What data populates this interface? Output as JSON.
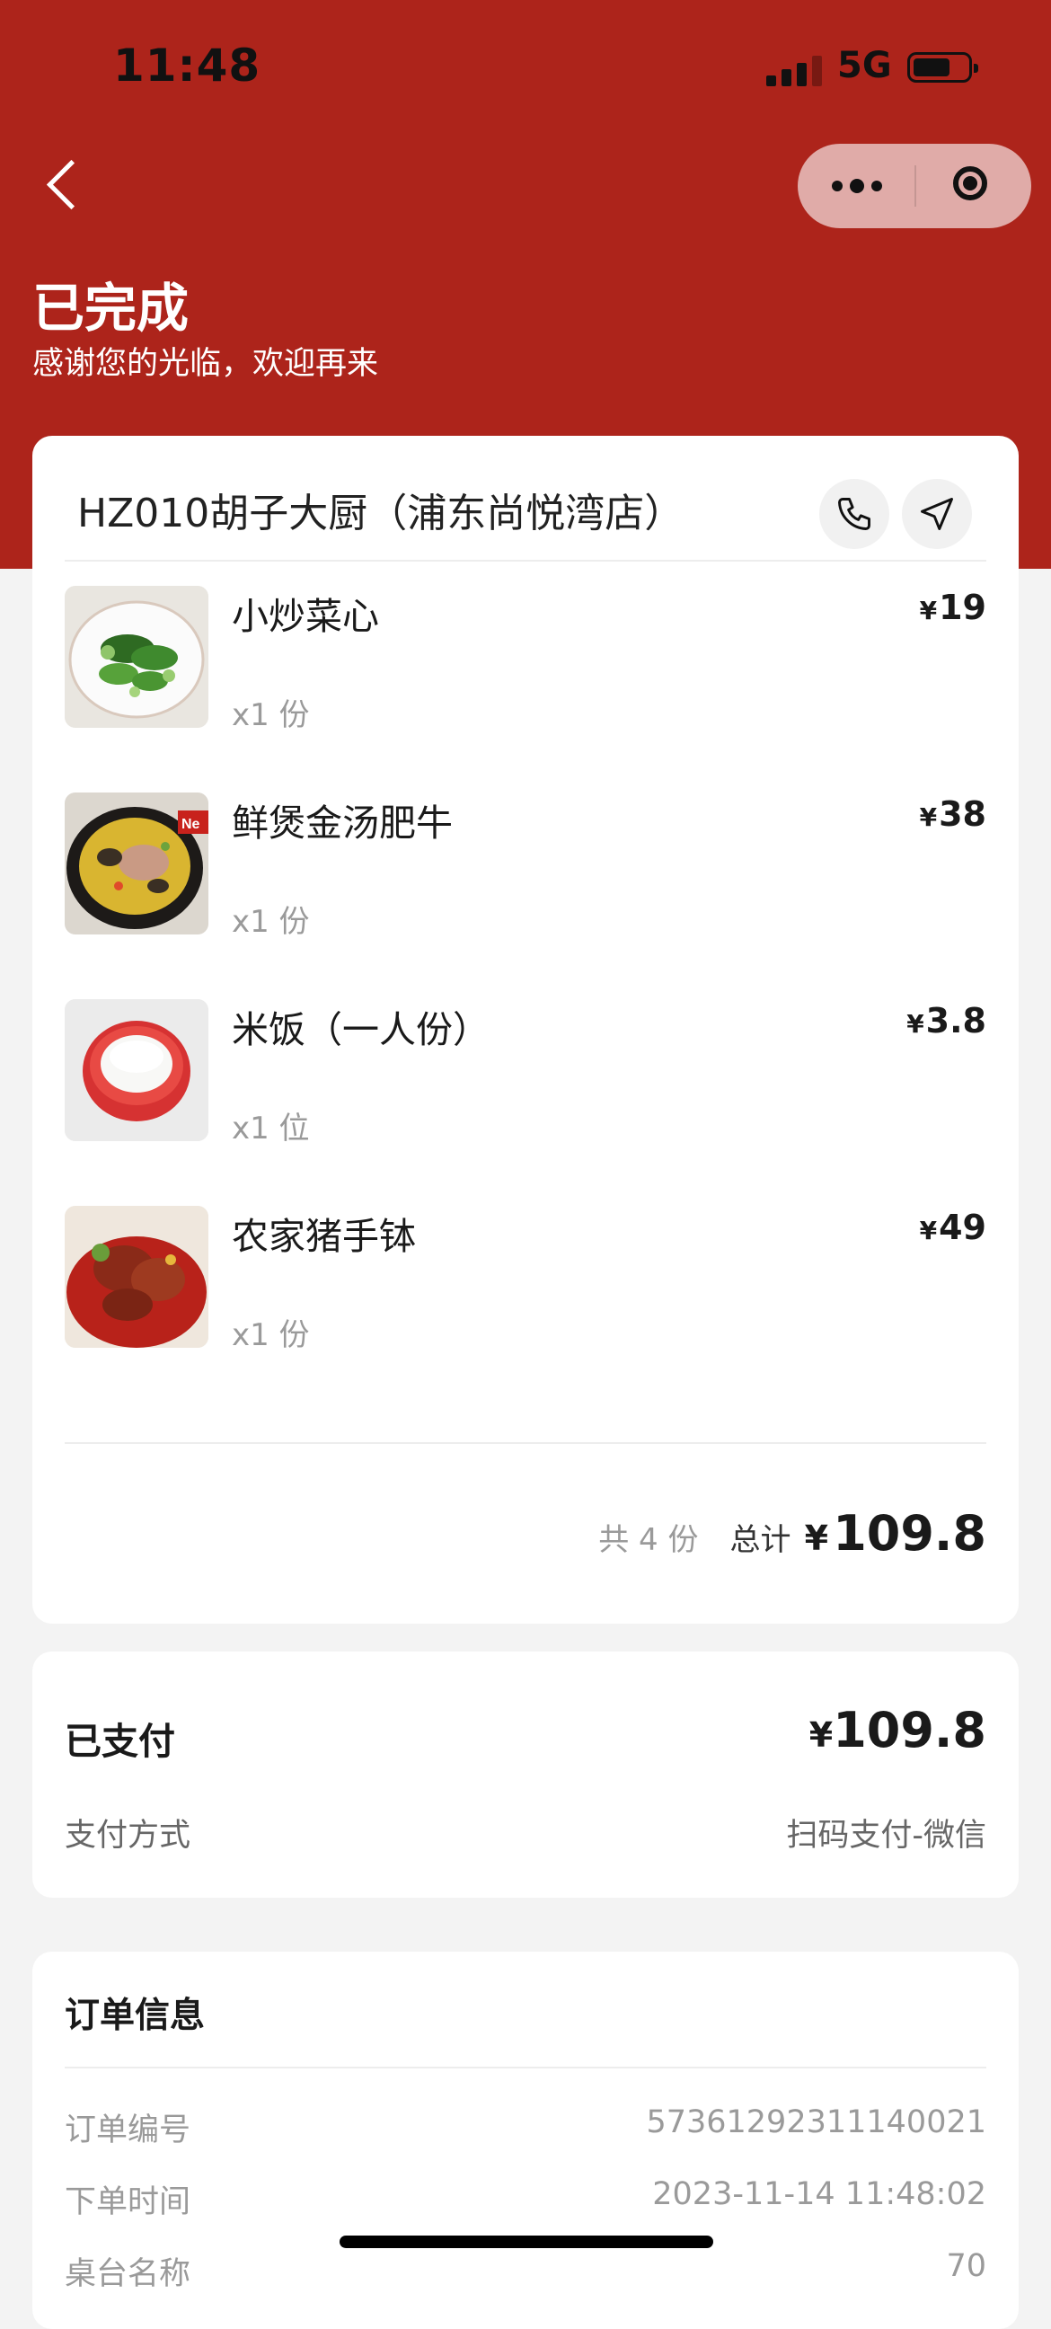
{
  "status_bar": {
    "time": "11:48",
    "network": "5G"
  },
  "header": {
    "status_title": "已完成",
    "status_subtitle": "感谢您的光临，欢迎再来"
  },
  "store": {
    "name": "HZ010胡子大厨（浦东尚悦湾店）"
  },
  "items": [
    {
      "name": "小炒菜心",
      "qty": "x1 份",
      "yen": "¥",
      "price": "19"
    },
    {
      "name": "鲜煲金汤肥牛",
      "qty": "x1 份",
      "yen": "¥",
      "price": "38"
    },
    {
      "name": "米饭（一人份）",
      "qty": "x1 位",
      "yen": "¥",
      "price": "3.8"
    },
    {
      "name": "农家猪手钵",
      "qty": "x1 份",
      "yen": "¥",
      "price": "49"
    }
  ],
  "summary": {
    "count": "共 4 份",
    "total_label": "总计",
    "yen": "¥",
    "total": "109.8"
  },
  "payment": {
    "label": "已支付",
    "yen": "¥",
    "amount": "109.8",
    "method_label": "支付方式",
    "method_value": "扫码支付-微信"
  },
  "order_info": {
    "title": "订单信息",
    "rows": [
      {
        "label": "订单编号",
        "value": "57361292311140021"
      },
      {
        "label": "下单时间",
        "value": "2023-11-14 11:48:02"
      },
      {
        "label": "桌台名称",
        "value": "70"
      }
    ]
  },
  "colors": {
    "brand_red": "#ad241b",
    "background": "#f3f3f3"
  }
}
